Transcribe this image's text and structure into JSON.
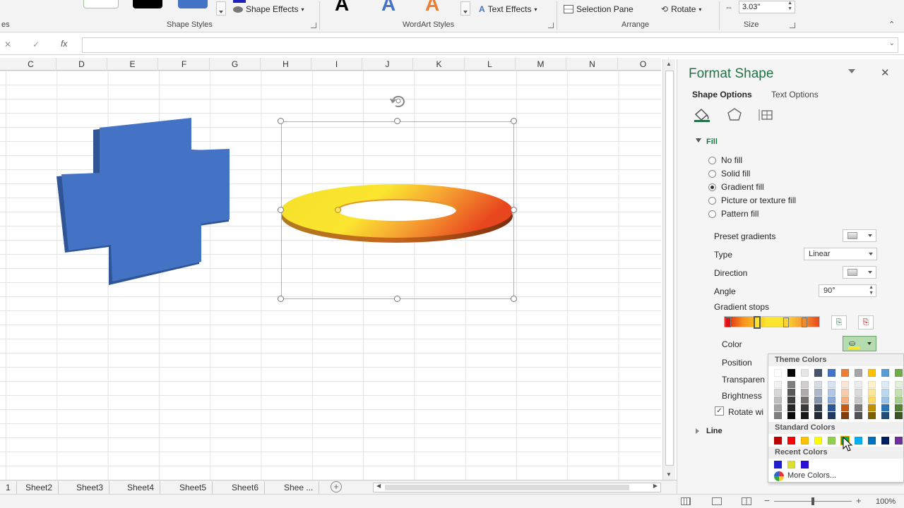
{
  "ribbon": {
    "shape_styles_label": "Shape Styles",
    "shape_effects": "Shape Effects",
    "wordart_styles_label": "WordArt Styles",
    "text_effects": "Text Effects",
    "selection_pane": "Selection Pane",
    "rotate": "Rotate",
    "arrange_label": "Arrange",
    "size_value": "3.03\"",
    "size_label": "Size",
    "left_partial_label": "es"
  },
  "formula_bar": {
    "fx": "fx",
    "cancel": "✕",
    "enter": "✓",
    "value": ""
  },
  "columns": [
    "C",
    "D",
    "E",
    "F",
    "G",
    "H",
    "I",
    "J",
    "K",
    "L",
    "M",
    "N",
    "O"
  ],
  "sheet_tabs": [
    "1",
    "Sheet2",
    "Sheet3",
    "Sheet4",
    "Sheet5",
    "Sheet6",
    "Shee ..."
  ],
  "format_pane": {
    "title": "Format Shape",
    "tab_shape_options": "Shape Options",
    "tab_text_options": "Text Options",
    "fill_section": "Fill",
    "fill_options": [
      {
        "label": "No fill",
        "selected": false
      },
      {
        "label": "Solid fill",
        "selected": false
      },
      {
        "label": "Gradient fill",
        "selected": true
      },
      {
        "label": "Picture or texture fill",
        "selected": false
      },
      {
        "label": "Pattern fill",
        "selected": false
      }
    ],
    "preset_gradients": "Preset gradients",
    "type_label": "Type",
    "type_value": "Linear",
    "direction_label": "Direction",
    "angle_label": "Angle",
    "angle_value": "90°",
    "gradient_stops": "Gradient stops",
    "color_label": "Color",
    "position_label": "Position",
    "transparency_label": "Transparen",
    "brightness_label": "Brightness",
    "rotate_label": "Rotate wi",
    "line_section": "Line"
  },
  "palette": {
    "theme_colors": "Theme Colors",
    "standard_colors": "Standard Colors",
    "recent_colors": "Recent Colors",
    "more_colors": "More Colors...",
    "theme_top": [
      "#ffffff",
      "#000000",
      "#e7e6e6",
      "#44546a",
      "#4472c4",
      "#ed7d31",
      "#a5a5a5",
      "#ffc000",
      "#5b9bd5",
      "#70ad47"
    ],
    "theme_shades": [
      [
        "#f2f2f2",
        "#7f7f7f",
        "#d0cece",
        "#d6dce4",
        "#d9e2f3",
        "#fbe5d5",
        "#ededed",
        "#fff2cc",
        "#deebf6",
        "#e2efd9"
      ],
      [
        "#d8d8d8",
        "#595959",
        "#aeabab",
        "#adb9ca",
        "#b4c6e7",
        "#f7cbac",
        "#dbdbdb",
        "#fee599",
        "#bdd7ee",
        "#c5e0b3"
      ],
      [
        "#bfbfbf",
        "#3f3f3f",
        "#757070",
        "#8496b0",
        "#8eaadb",
        "#f4b183",
        "#c9c9c9",
        "#ffd965",
        "#9cc3e5",
        "#a8d08d"
      ],
      [
        "#a5a5a5",
        "#262626",
        "#3a3838",
        "#323f4f",
        "#2f5496",
        "#c55a11",
        "#7b7b7b",
        "#bf9000",
        "#2e75b5",
        "#538135"
      ],
      [
        "#7f7f7f",
        "#0c0c0c",
        "#171616",
        "#222a35",
        "#1f3864",
        "#833c0b",
        "#525252",
        "#7f6000",
        "#1e4e79",
        "#375623"
      ]
    ],
    "standard": [
      "#c00000",
      "#ff0000",
      "#ffc000",
      "#ffff00",
      "#92d050",
      "#00b050",
      "#00b0f0",
      "#0070c0",
      "#002060",
      "#7030a0"
    ],
    "recent": [
      "#1f1fcf",
      "#dede30",
      "#2a0fd8"
    ]
  },
  "status": {
    "zoom": "100%"
  },
  "colors": {
    "accent": "#217346",
    "blue_shape": "#4472c4"
  }
}
